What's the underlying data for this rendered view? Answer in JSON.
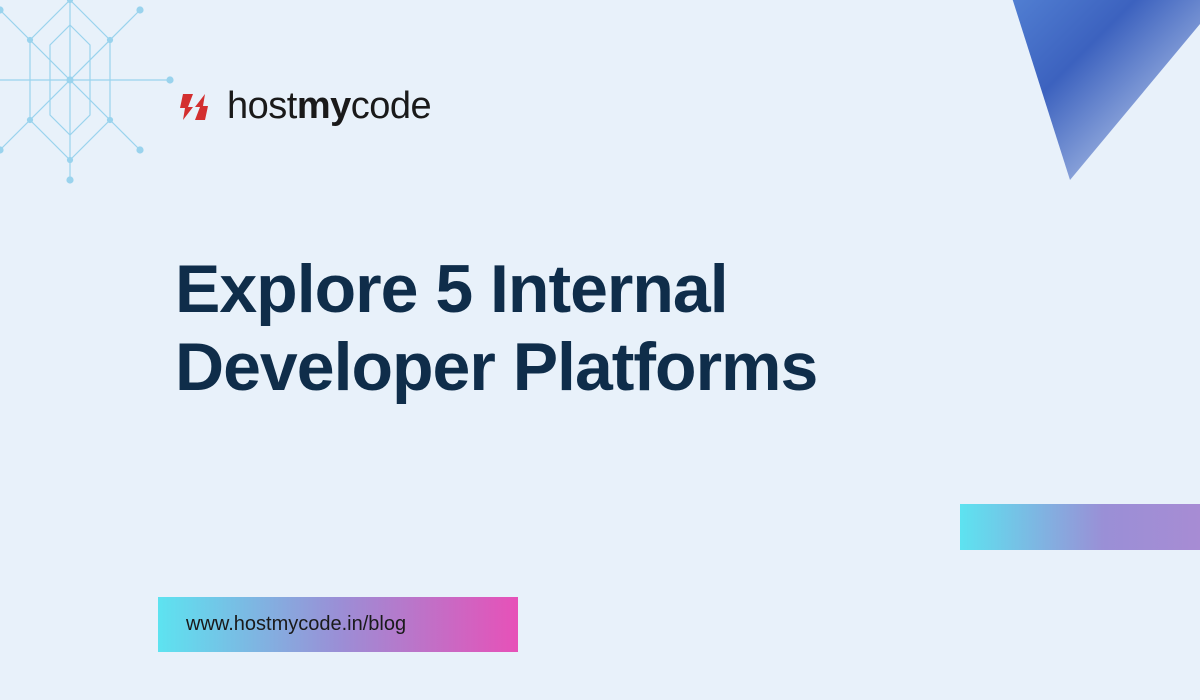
{
  "logo": {
    "text_normal_1": "host",
    "text_bold": "my",
    "text_normal_2": "code"
  },
  "headline": "Explore 5 Internal Developer Platforms",
  "url": "www.hostmycode.in/blog",
  "colors": {
    "background": "#e8f1fa",
    "headline": "#0f2d4a",
    "logo_red": "#d32f2f"
  }
}
